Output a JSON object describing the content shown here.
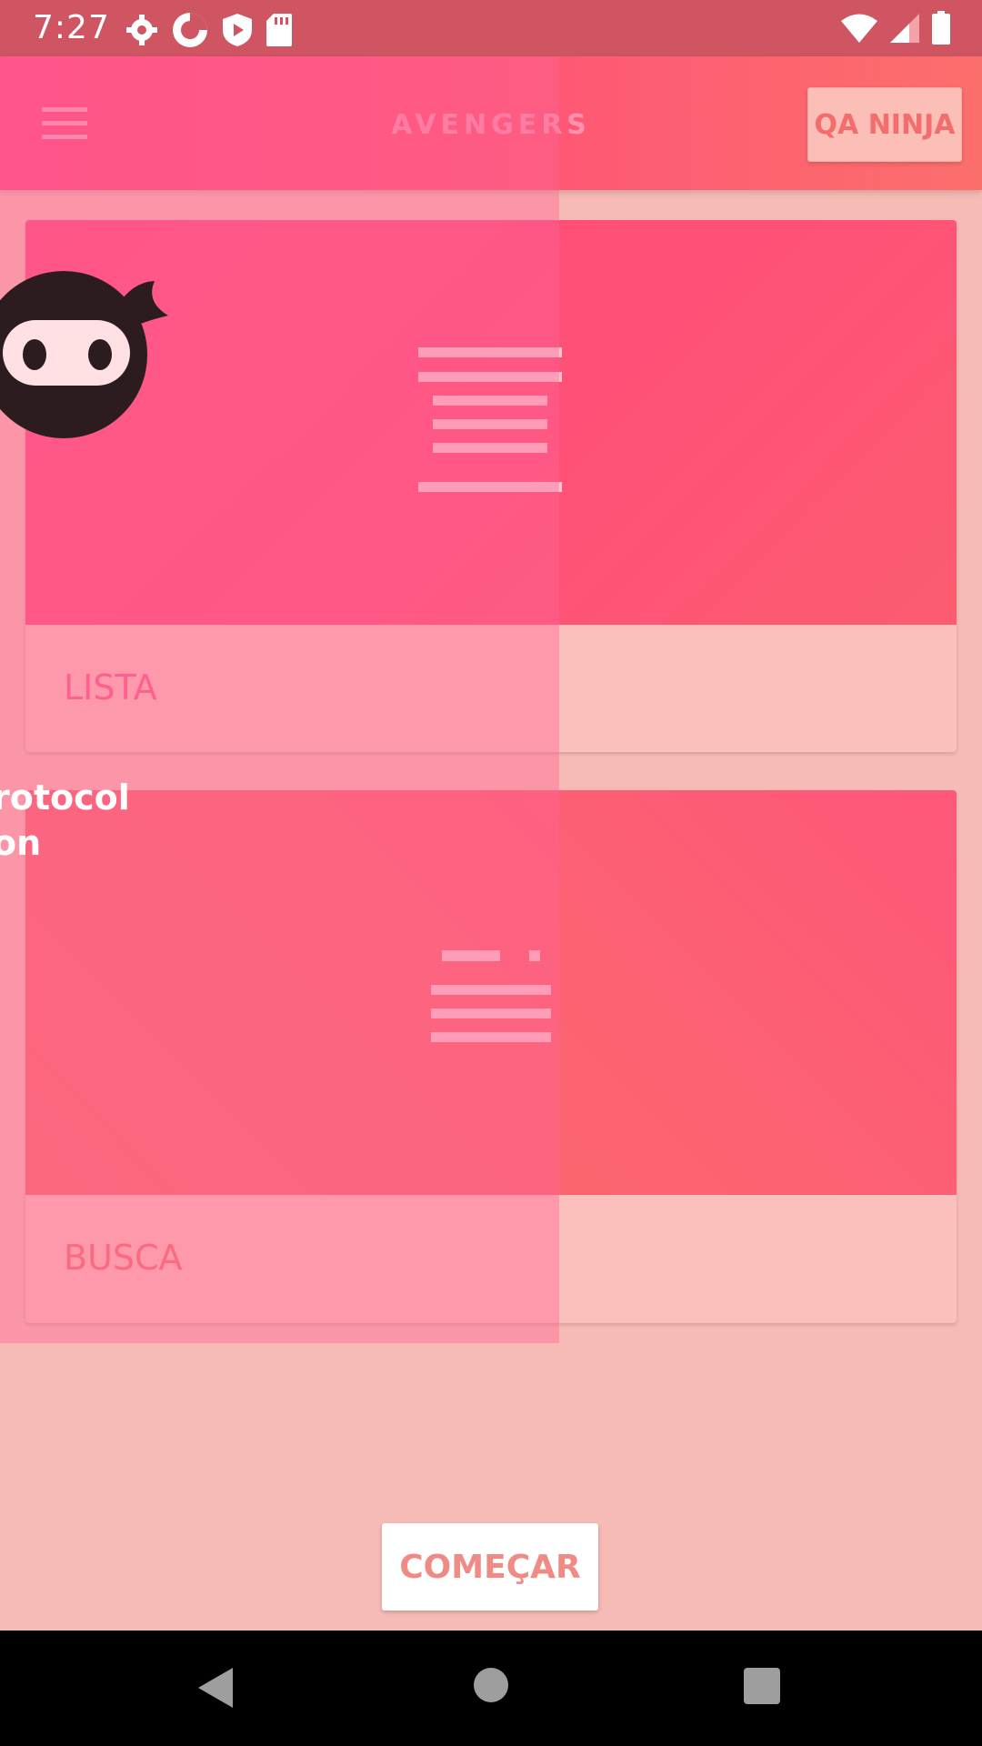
{
  "status_bar": {
    "time": "7:27",
    "left_icons": [
      "settings-icon",
      "sync-icon",
      "shield-icon",
      "sd-card-icon"
    ],
    "right_icons": [
      "wifi-icon",
      "signal-icon",
      "battery-icon"
    ]
  },
  "toolbar": {
    "menu_icon": "hamburger-menu-icon",
    "title": "AVENGERS",
    "action_label": "QA NINJA"
  },
  "cards": [
    {
      "label": "LISTA",
      "label_color": "#ff5e8a",
      "media_icon": "list-placeholder-icon"
    },
    {
      "label": "BUSCA",
      "label_color": "#f66f71",
      "media_icon": "search-placeholder-icon"
    }
  ],
  "overlay": {
    "logo": "ninja-logo",
    "lines": [
      "rotocol",
      "on"
    ]
  },
  "start_button": {
    "label": "COMEÇAR"
  },
  "nav_bar": {
    "back": "back-icon",
    "home": "home-icon",
    "recents": "recents-icon"
  },
  "colors": {
    "status_bar": "#ce5561",
    "toolbar_start": "#ff4a82",
    "toolbar_end": "#fb6f6b",
    "page_background": "#f7bbb6",
    "card_media_pink": "#ff5079",
    "card_media_coral": "#f96a6c"
  }
}
